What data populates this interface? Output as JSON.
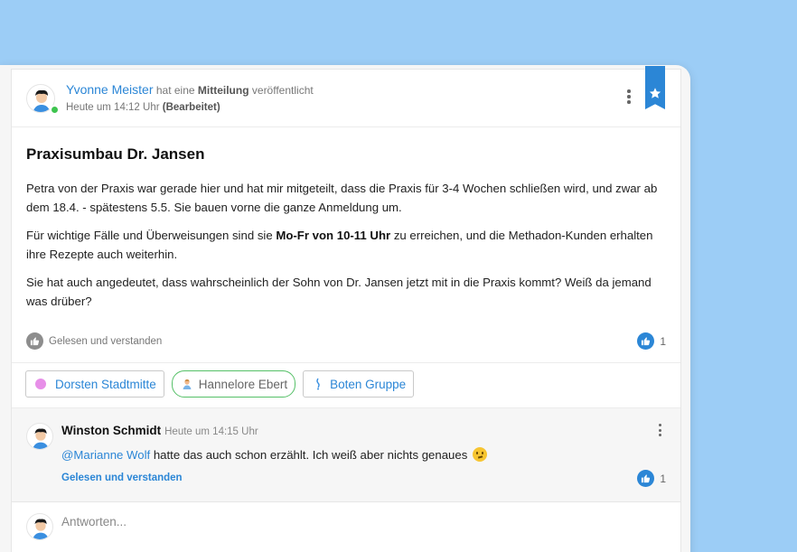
{
  "post": {
    "author": "Yvonne Meister",
    "action_pre": "hat eine",
    "action_type": "Mitteilung",
    "action_post": "veröffentlicht",
    "time": "Heute um 14:12 Uhr",
    "edited": "(Bearbeitet)",
    "title": "Praxisumbau Dr. Jansen",
    "paragraph1": "Petra von der Praxis war gerade hier und hat mir mitgeteilt, dass die Praxis für 3-4 Wochen schließen wird, und zwar ab dem 18.4. - spätestens 5.5. Sie bauen vorne die ganze Anmeldung um.",
    "paragraph2_pre": "Für wichtige Fälle und Überweisungen sind sie",
    "paragraph2_bold": "Mo-Fr von 10-11 Uhr",
    "paragraph2_post": "zu erreichen, und die Methadon-Kunden erhalten ihre Rezepte auch weiterhin.",
    "paragraph3": "Sie hat auch angedeutet, dass wahrscheinlich der Sohn von Dr. Jansen jetzt mit in die Praxis kommt? Weiß da jemand was drüber?",
    "ack_label": "Gelesen und verstanden",
    "like_count": "1"
  },
  "tags": [
    {
      "label": "Dorsten Stadtmitte"
    },
    {
      "label": "Hannelore Ebert"
    },
    {
      "label": "Boten Gruppe"
    }
  ],
  "comment": {
    "author": "Winston Schmidt",
    "time": "Heute um 14:15 Uhr",
    "mention": "@Marianne Wolf",
    "text": "hatte das auch schon erzählt. Ich weiß aber nichts genaues",
    "ack_label": "Gelesen und verstanden",
    "like_count": "1"
  },
  "reply": {
    "placeholder": "Antworten..."
  },
  "colors": {
    "accent": "#2b86d6",
    "online": "#3ec44f",
    "background": "#9ccdf6"
  }
}
